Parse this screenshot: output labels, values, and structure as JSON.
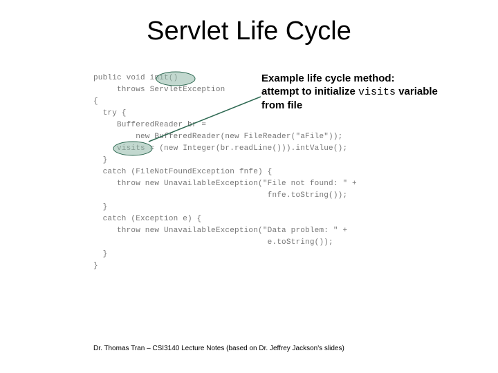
{
  "title": "Servlet Life Cycle",
  "callout": {
    "line1": "Example life cycle method:",
    "line2a": "attempt to initialize ",
    "line2b_mono": "visits",
    "line2c": " variable",
    "line3": "from file"
  },
  "code": {
    "lines": [
      "public void init()",
      "     throws ServletException",
      "{",
      "  try {",
      "     BufferedReader br =",
      "         new BufferedReader(new FileReader(\"aFile\"));",
      "     visits = (new Integer(br.readLine())).intValue();",
      "  }",
      "  catch (FileNotFoundException fnfe) {",
      "     throw new UnavailableException(\"File not found: \" +",
      "                                     fnfe.toString());",
      "  }",
      "  catch (Exception e) {",
      "     throw new UnavailableException(\"Data problem: \" +",
      "                                     e.toString());",
      "  }",
      "}"
    ]
  },
  "footer": "Dr. Thomas Tran – CSI3140 Lecture Notes (based on Dr. Jeffrey Jackson's slides)"
}
